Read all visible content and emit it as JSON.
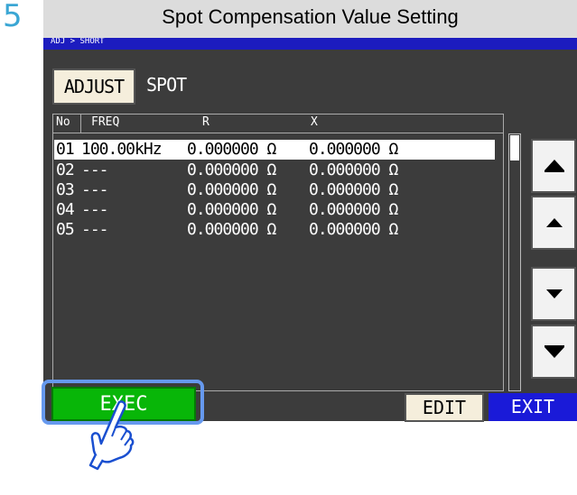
{
  "step": "5",
  "heading": "Spot Compensation Value Setting",
  "screen": {
    "breadcrumb": "ADJ > SHORT",
    "adjust_button": "ADJUST",
    "mode": "SPOT",
    "table": {
      "headers": {
        "no": "No",
        "freq": "FREQ",
        "r": "R",
        "x": "X"
      },
      "rows": [
        {
          "no": "01",
          "freq": "100.00kHz",
          "r": "0.000000 Ω",
          "x": "0.000000 Ω",
          "selected": true
        },
        {
          "no": "02",
          "freq": "---",
          "r": "0.000000 Ω",
          "x": "0.000000 Ω"
        },
        {
          "no": "03",
          "freq": "---",
          "r": "0.000000 Ω",
          "x": "0.000000 Ω"
        },
        {
          "no": "04",
          "freq": "---",
          "r": "0.000000 Ω",
          "x": "0.000000 Ω"
        },
        {
          "no": "05",
          "freq": "---",
          "r": "0.000000 Ω",
          "x": "0.000000 Ω"
        }
      ]
    },
    "exec_button": "EXEC",
    "edit_button": "EDIT",
    "exit_button": "EXIT",
    "icons": {
      "page_up": "double-up-arrow-icon",
      "line_up": "up-arrow-icon",
      "line_down": "down-arrow-icon",
      "page_down": "double-down-arrow-icon",
      "pointer": "pointing-hand-icon"
    }
  },
  "colors": {
    "step_number": "#3aa6d4",
    "title_bar": "#1c1cbf",
    "exec": "#08b608",
    "exit": "#1a1ad8",
    "highlight": "#6699ee"
  }
}
